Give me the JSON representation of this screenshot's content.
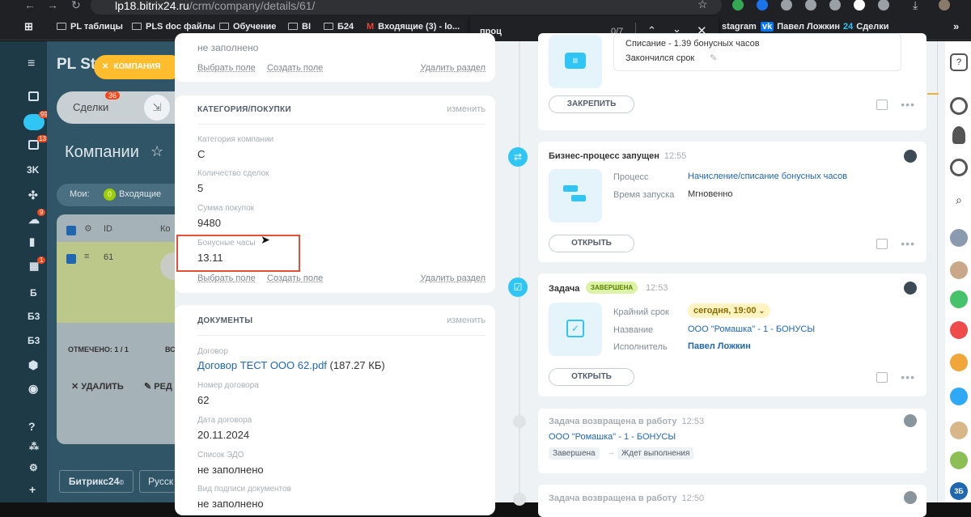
{
  "browser": {
    "url_host": "lp18.bitrix24.ru",
    "url_path": "/crm/company/details/61/",
    "bookmarks": [
      "PL таблицы",
      "PLS doc файлы",
      "Обучение",
      "BI",
      "Б24",
      "Входящие (3) - lo...",
      "stagram",
      "Павел Ложкин",
      "Сделки"
    ],
    "bookmarks_more": "»"
  },
  "find": {
    "query": "проц",
    "count": "0/7"
  },
  "left_nav": {
    "labels": [
      "3K",
      "Б",
      "Б3",
      "Б3"
    ],
    "badges": [
      "99+",
      "13",
      "9",
      "1"
    ]
  },
  "background": {
    "brand": "PL St",
    "tag": "КОМПАНИЯ",
    "deals_label": "Сделки",
    "deals_badge": "36",
    "page_title": "Компании",
    "my_label": "Мои:",
    "inbox_count": "0",
    "inbox_label": "Входящие",
    "col_id": "ID",
    "col_co": "Ко",
    "row_id": "61",
    "checked": "ОТМЕЧЕНО: 1 / 1",
    "checked_right": "ВС",
    "delete": "УДАЛИТЬ",
    "edit": "РЕД",
    "bitrix_btn": "Битрикс24",
    "lang_btn": "Русск"
  },
  "details": {
    "top": {
      "value": "не заполнено",
      "link_select": "Выбрать поле",
      "link_create": "Создать поле",
      "link_delete": "Удалить раздел"
    },
    "category": {
      "title": "КАТЕГОРИЯ/ПОКУПКИ",
      "action": "изменить",
      "fields": [
        {
          "label": "Категория компании",
          "value": "С"
        },
        {
          "label": "Количество сделок",
          "value": "5"
        },
        {
          "label": "Сумма покупок",
          "value": "9480"
        },
        {
          "label": "Бонусные часы",
          "value": "13.11"
        }
      ],
      "link_select": "Выбрать поле",
      "link_create": "Создать поле",
      "link_delete": "Удалить раздел"
    },
    "documents": {
      "title": "ДОКУМЕНТЫ",
      "action": "изменить",
      "contract_label": "Договор",
      "contract_link": "Договор ТЕСТ ООО 62.pdf",
      "contract_size": "(187.27 КБ)",
      "fields": [
        {
          "label": "Номер договора",
          "value": "62"
        },
        {
          "label": "Дата договора",
          "value": "20.11.2024"
        },
        {
          "label": "Список ЭДО",
          "value": "не заполнено"
        },
        {
          "label": "Вид подписи документов",
          "value": "не заполнено"
        }
      ]
    }
  },
  "timeline": {
    "top_card": {
      "line1": "Списание - 1.39 бонусных часов",
      "line2": "Закончился срок",
      "pin": "ЗАКРЕПИТЬ"
    },
    "bp_card": {
      "title": "Бизнес-процесс запущен",
      "time": "12:55",
      "k1": "Процесс",
      "v1": "Начисление/списание бонусных часов",
      "k2": "Время запуска",
      "v2": "Мгновенно",
      "button": "ОТКРЫТЬ"
    },
    "task_card": {
      "title": "Задача",
      "badge": "ЗАВЕРШЕНА",
      "time": "12:53",
      "k1": "Крайний срок",
      "v1": "сегодня, 19:00",
      "k2": "Название",
      "v2": "ООО \"Ромашка\" - 1 - БОНУСЫ",
      "k3": "Исполнитель",
      "v3": "Павел Ложкин",
      "button": "ОТКРЫТЬ"
    },
    "returned_card": {
      "title": "Задача возвращена в работу",
      "time": "12:53",
      "link": "ООО \"Ромашка\" - 1 - БОНУСЫ",
      "from": "Завершена",
      "arrow": "→",
      "to": "Ждет выполнения"
    },
    "returned_card2": {
      "title": "Задача возвращена в работу",
      "time": "12:50"
    }
  },
  "right": {
    "badge": "3Б"
  },
  "colors": {
    "accent_blue": "#2fc6f6",
    "link": "#2067b0",
    "highlight": "#e0503a",
    "tag_yellow": "#ffbd2e"
  }
}
